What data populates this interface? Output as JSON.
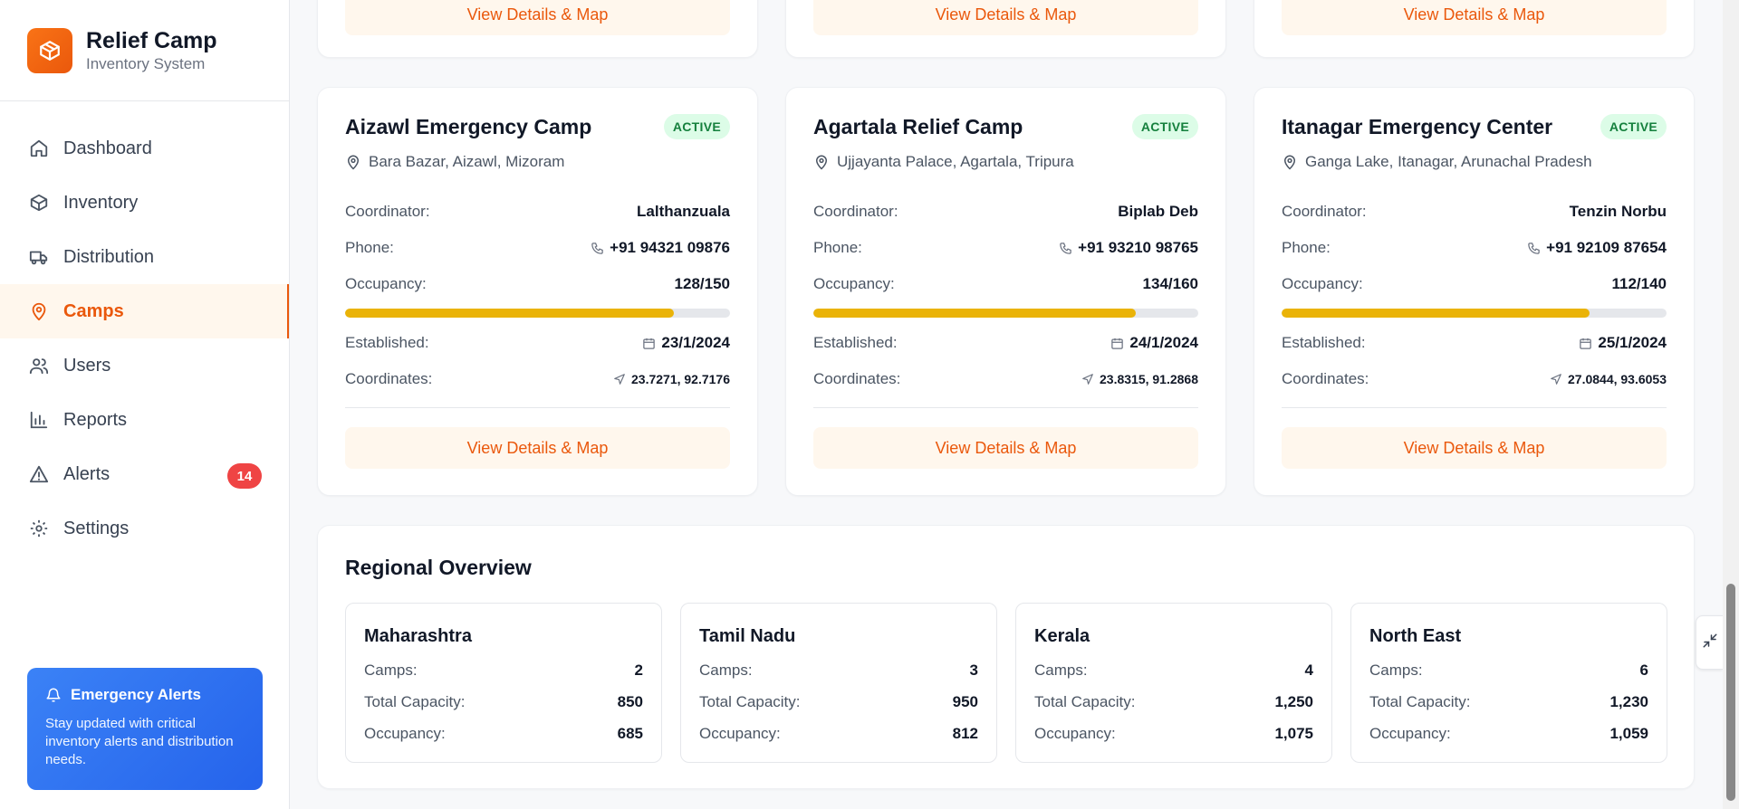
{
  "brand": {
    "title": "Relief Camp",
    "subtitle": "Inventory System"
  },
  "nav": [
    {
      "label": "Dashboard",
      "icon": "home-icon"
    },
    {
      "label": "Inventory",
      "icon": "box-icon"
    },
    {
      "label": "Distribution",
      "icon": "truck-icon"
    },
    {
      "label": "Camps",
      "icon": "map-pin-icon",
      "active": true
    },
    {
      "label": "Users",
      "icon": "users-icon"
    },
    {
      "label": "Reports",
      "icon": "bar-chart-icon"
    },
    {
      "label": "Alerts",
      "icon": "alert-triangle-icon",
      "badge": "14"
    },
    {
      "label": "Settings",
      "icon": "gear-icon"
    }
  ],
  "emergency": {
    "title": "Emergency Alerts",
    "text": "Stay updated with critical inventory alerts and distribution needs."
  },
  "map_button_label": "View Details & Map",
  "labels": {
    "coordinator": "Coordinator:",
    "phone": "Phone:",
    "occupancy": "Occupancy:",
    "established": "Established:",
    "coordinates": "Coordinates:"
  },
  "camps": [
    {
      "name": "Aizawl Emergency Camp",
      "status": "ACTIVE",
      "location": "Bara Bazar, Aizawl, Mizoram",
      "coordinator": "Lalthanzuala",
      "phone": "+91 94321 09876",
      "occupancy": "128/150",
      "occupancy_fraction": 0.853,
      "established": "23/1/2024",
      "coordinates": "23.7271, 92.7176"
    },
    {
      "name": "Agartala Relief Camp",
      "status": "ACTIVE",
      "location": "Ujjayanta Palace, Agartala, Tripura",
      "coordinator": "Biplab Deb",
      "phone": "+91 93210 98765",
      "occupancy": "134/160",
      "occupancy_fraction": 0.8375,
      "established": "24/1/2024",
      "coordinates": "23.8315, 91.2868"
    },
    {
      "name": "Itanagar Emergency Center",
      "status": "ACTIVE",
      "location": "Ganga Lake, Itanagar, Arunachal Pradesh",
      "coordinator": "Tenzin Norbu",
      "phone": "+91 92109 87654",
      "occupancy": "112/140",
      "occupancy_fraction": 0.8,
      "established": "25/1/2024",
      "coordinates": "27.0844, 93.6053"
    }
  ],
  "regional": {
    "title": "Regional Overview",
    "labels": {
      "camps": "Camps:",
      "capacity": "Total Capacity:",
      "occupancy": "Occupancy:"
    },
    "regions": [
      {
        "name": "Maharashtra",
        "camps": "2",
        "capacity": "850",
        "occupancy": "685"
      },
      {
        "name": "Tamil Nadu",
        "camps": "3",
        "capacity": "950",
        "occupancy": "812"
      },
      {
        "name": "Kerala",
        "camps": "4",
        "capacity": "1,250",
        "occupancy": "1,075"
      },
      {
        "name": "North East",
        "camps": "6",
        "capacity": "1,230",
        "occupancy": "1,059"
      }
    ]
  },
  "colors": {
    "accent": "#ea580c",
    "active_bg": "#fff7ed",
    "status_green": "#15803d",
    "progress": "#eab308",
    "alert_blue": "#2563eb",
    "badge_red": "#ef4444"
  }
}
